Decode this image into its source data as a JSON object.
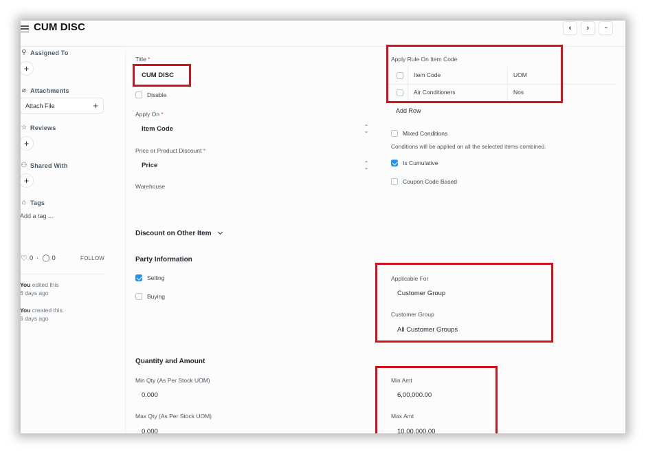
{
  "header": {
    "title": "CUM DISC",
    "prev_label": "‹",
    "next_label": "›",
    "more_label": "···"
  },
  "sidebar": {
    "assigned_to": "Assigned To",
    "attachments": "Attachments",
    "attach_file": "Attach File",
    "reviews": "Reviews",
    "shared_with": "Shared With",
    "tags": "Tags",
    "add_tag_placeholder": "Add a tag ...",
    "likes": "0",
    "comments": "0",
    "follow": "FOLLOW",
    "activity": [
      {
        "who": "You",
        "action": " edited this",
        "when": "6 days ago"
      },
      {
        "who": "You",
        "action": " created this",
        "when": "6 days ago"
      }
    ]
  },
  "form": {
    "title_label": "Title",
    "title_value": "CUM DISC",
    "disable_label": "Disable",
    "disable_checked": false,
    "apply_on_label": "Apply On",
    "apply_on_value": "Item Code",
    "price_or_product_label": "Price or Product Discount",
    "price_or_product_value": "Price",
    "warehouse_label": "Warehouse",
    "apply_rule_label": "Apply Rule On Item Code",
    "items_table": {
      "columns": [
        "Item Code",
        "UOM"
      ],
      "rows": [
        {
          "item_code": "Air Conditioners",
          "uom": "Nos"
        }
      ],
      "add_row": "Add Row"
    },
    "mixed_conditions_label": "Mixed Conditions",
    "mixed_conditions_checked": false,
    "mixed_conditions_help": "Conditions will be applied on all the selected items combined.",
    "is_cumulative_label": "Is Cumulative",
    "is_cumulative_checked": true,
    "coupon_code_label": "Coupon Code Based",
    "coupon_code_checked": false,
    "discount_other_item": "Discount on Other Item",
    "party_information": "Party Information",
    "selling_label": "Selling",
    "selling_checked": true,
    "buying_label": "Buying",
    "buying_checked": false,
    "applicable_for_label": "Applicable For",
    "applicable_for_value": "Customer Group",
    "customer_group_label": "Customer Group",
    "customer_group_value": "All Customer Groups",
    "quantity_amount": "Quantity and Amount",
    "min_qty_label": "Min Qty (As Per Stock UOM)",
    "min_qty_value": "0.000",
    "max_qty_label": "Max Qty (As Per Stock UOM)",
    "max_qty_value": "0.000",
    "min_amt_label": "Min Amt",
    "min_amt_value": "6,00,000.00",
    "max_amt_label": "Max Amt",
    "max_amt_value": "10,00,000.00",
    "required_marker": "*"
  },
  "colors": {
    "highlight": "#d0121b",
    "checkbox_on": "#2490ef"
  }
}
